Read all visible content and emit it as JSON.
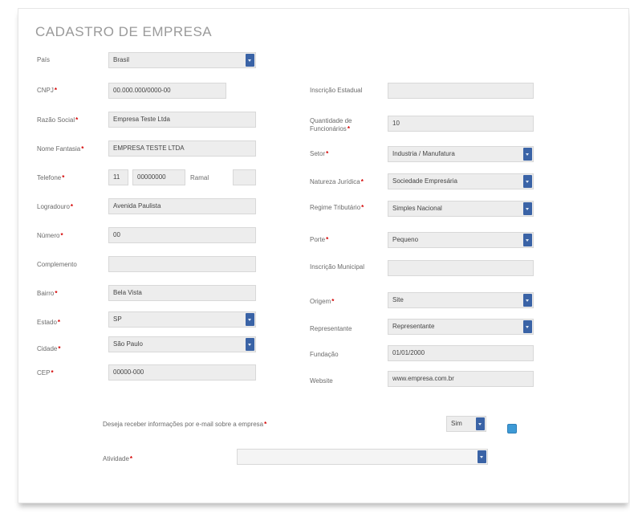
{
  "title": "CADASTRO DE EMPRESA",
  "left": {
    "pais": {
      "label": "País",
      "value": "Brasil"
    },
    "cnpj": {
      "label": "CNPJ",
      "value": "00.000.000/0000-00"
    },
    "razao_social": {
      "label": "Razão Social",
      "value": "Empresa Teste Ltda"
    },
    "nome_fantasia": {
      "label": "Nome Fantasia",
      "value": "EMPRESA TESTE LTDA"
    },
    "telefone": {
      "label": "Telefone",
      "ddd": "11",
      "numero": "00000000",
      "ramal_label": "Ramal",
      "ramal_value": ""
    },
    "logradouro": {
      "label": "Logradouro",
      "value": "Avenida Paulista"
    },
    "numero": {
      "label": "Número",
      "value": "00"
    },
    "complemento": {
      "label": "Complemento",
      "value": ""
    },
    "bairro": {
      "label": "Bairro",
      "value": "Bela Vista"
    },
    "estado": {
      "label": "Estado",
      "value": "SP"
    },
    "cidade": {
      "label": "Cidade",
      "value": "São Paulo"
    },
    "cep": {
      "label": "CEP",
      "value": "00000-000"
    }
  },
  "right": {
    "inscricao_estadual": {
      "label": "Inscrição Estadual",
      "value": ""
    },
    "quantidade_funcionarios": {
      "label": "Quantidade de Funcionários",
      "value": "10"
    },
    "setor": {
      "label": "Setor",
      "value": "Industria / Manufatura"
    },
    "natureza_juridica": {
      "label": "Natureza Jurídica",
      "value": "Sociedade Empresária"
    },
    "regime_tributario": {
      "label": "Regime Tributário",
      "value": "Simples Nacional"
    },
    "porte": {
      "label": "Porte",
      "value": "Pequeno"
    },
    "inscricao_municipal": {
      "label": "Inscrição Municipal",
      "value": ""
    },
    "origem": {
      "label": "Origem",
      "value": "Site"
    },
    "representante": {
      "label": "Representante",
      "value": "Representante"
    },
    "fundacao": {
      "label": "Fundação",
      "value": "01/01/2000"
    },
    "website": {
      "label": "Website",
      "value": "www.empresa.com.br"
    }
  },
  "bottom": {
    "question": {
      "label": "Deseja receber informações por e-mail sobre a empresa",
      "value": "Sim"
    },
    "atividade": {
      "label": "Atividade",
      "value": ""
    }
  }
}
